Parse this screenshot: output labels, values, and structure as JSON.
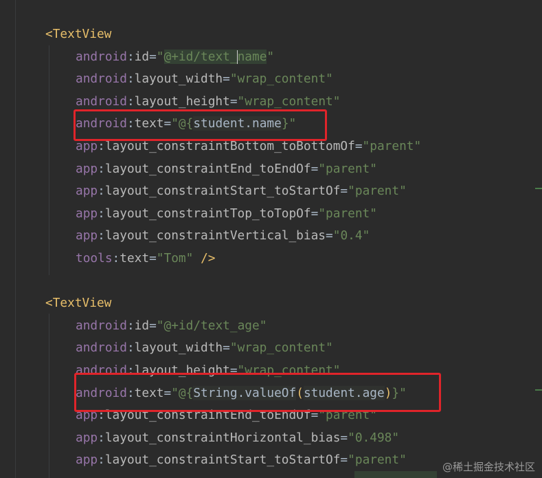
{
  "editor": {
    "blocks": [
      {
        "tag": "TextView",
        "lines": [
          {
            "ns": "android",
            "attr": "id",
            "value": "@+id/text_name"
          },
          {
            "ns": "android",
            "attr": "layout_width",
            "value": "wrap_content"
          },
          {
            "ns": "android",
            "attr": "layout_height",
            "value": "wrap_content"
          },
          {
            "ns": "android",
            "attr": "text",
            "value_prefix": "@{",
            "value_expr": "student.name",
            "value_suffix": "}"
          },
          {
            "ns": "app",
            "attr": "layout_constraintBottom_toBottomOf",
            "value": "parent"
          },
          {
            "ns": "app",
            "attr": "layout_constraintEnd_toEndOf",
            "value": "parent"
          },
          {
            "ns": "app",
            "attr": "layout_constraintStart_toStartOf",
            "value": "parent"
          },
          {
            "ns": "app",
            "attr": "layout_constraintTop_toTopOf",
            "value": "parent"
          },
          {
            "ns": "app",
            "attr": "layout_constraintVertical_bias",
            "value": "0.4"
          },
          {
            "ns": "tools",
            "attr": "text",
            "value": "Tom",
            "close": " />"
          }
        ]
      },
      {
        "tag": "TextView",
        "lines": [
          {
            "ns": "android",
            "attr": "id",
            "value": "@+id/text_age"
          },
          {
            "ns": "android",
            "attr": "layout_width",
            "value": "wrap_content"
          },
          {
            "ns": "android",
            "attr": "layout_height",
            "value": "wrap_content"
          },
          {
            "ns": "android",
            "attr": "text",
            "value_prefix": "@{",
            "value_expr_fn": "String.valueOf",
            "value_expr_arg": "student.age",
            "value_suffix": "}"
          },
          {
            "ns": "app",
            "attr": "layout_constraintEnd_toEndOf",
            "value": "parent"
          },
          {
            "ns": "app",
            "attr": "layout_constraintHorizontal_bias",
            "value": "0.498"
          },
          {
            "ns": "app",
            "attr": "layout_constraintStart_toStartOf",
            "value": "parent"
          }
        ]
      }
    ],
    "open_bracket": "<",
    "quote": "\"",
    "colon": ":",
    "equals": "="
  },
  "watermark": "@稀土掘金技术社区",
  "colors": {
    "background": "#2b2b2b",
    "tag": "#e8bf6a",
    "namespace": "#9876aa",
    "attribute": "#bababa",
    "string": "#6a8759",
    "highlight_box": "#e0242a"
  }
}
